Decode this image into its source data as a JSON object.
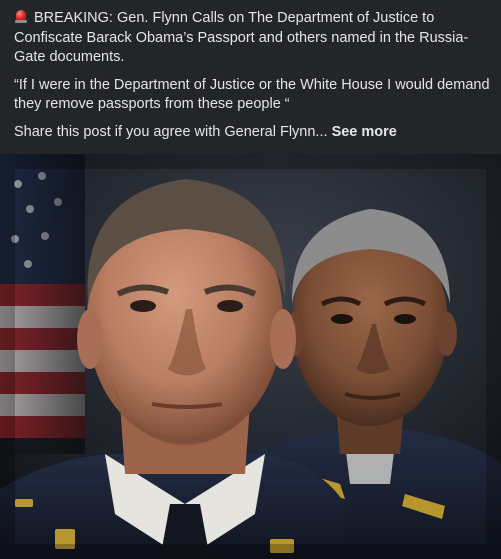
{
  "post": {
    "line1_emoji": "siren-icon",
    "headline": "BREAKING: Gen. Flynn Calls on The Department of Justice to Confiscate Barack Obama’s Passport and others named in the Russia-Gate documents.",
    "quote": "“If I were in the Department of Justice or the White House I would demand they remove passports from these people “",
    "share_text": "Share this post if you agree with General Flynn...",
    "see_more_label": "See more"
  },
  "image": {
    "subject": "portrait-two-men-military-uniform",
    "colors": {
      "background": "#1f232b",
      "flag_red": "#a3262b",
      "flag_blue": "#1d2b4a",
      "uniform": "#1a2236",
      "skin_front": "#b87d62",
      "skin_back": "#7a4d35",
      "hair_front": "#5a4e45",
      "hair_back": "#8c8c8c",
      "insignia": "#b8962e"
    }
  }
}
